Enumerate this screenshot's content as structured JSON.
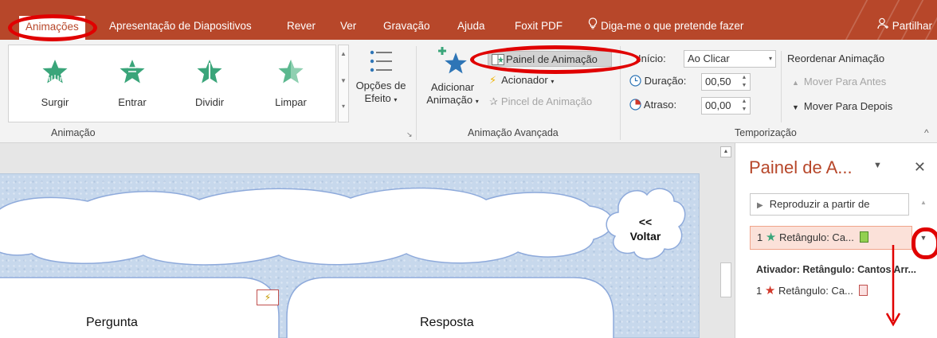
{
  "tabs": [
    {
      "label": "Animações",
      "active": true
    },
    {
      "label": "Apresentação de Diapositivos"
    },
    {
      "label": "Rever"
    },
    {
      "label": "Ver"
    },
    {
      "label": "Gravação"
    },
    {
      "label": "Ajuda"
    },
    {
      "label": "Foxit PDF"
    },
    {
      "label": "Diga-me o que pretende fazer",
      "icon": "lightbulb-icon"
    }
  ],
  "share_label": "Partilhar",
  "ribbon": {
    "animation_group": {
      "label": "Animação",
      "effects": [
        {
          "label": "Surgir",
          "icon": "star-appear-icon"
        },
        {
          "label": "Entrar",
          "icon": "star-fly-in-icon"
        },
        {
          "label": "Dividir",
          "icon": "star-split-icon"
        },
        {
          "label": "Limpar",
          "icon": "star-wipe-icon"
        }
      ],
      "effect_options_line1": "Opções de",
      "effect_options_line2": "Efeito"
    },
    "advanced_group": {
      "label": "Animação Avançada",
      "add_animation_line1": "Adicionar",
      "add_animation_line2": "Animação",
      "animation_pane": "Painel de Animação",
      "trigger": "Acionador",
      "animation_painter": "Pincel de Animação"
    },
    "timing_group": {
      "label": "Temporização",
      "start_label": "Início:",
      "start_value": "Ao Clicar",
      "duration_label": "Duração:",
      "duration_value": "00,50",
      "delay_label": "Atraso:",
      "delay_value": "00,00",
      "reorder_label": "Reordenar Animação",
      "move_earlier": "Mover Para Antes",
      "move_later": "Mover Para Depois"
    }
  },
  "slide": {
    "back_button_line1": "<<",
    "back_button_line2": "Voltar",
    "question_label": "Pergunta",
    "answer_label": "Resposta"
  },
  "pane": {
    "title": "Painel de A...",
    "play_from": "Reproduzir a partir de",
    "item1_number": "1",
    "item1_label": "Retângulo: Ca...",
    "trigger_label": "Ativador: Retângulo: Cantos Arr...",
    "item2_number": "1",
    "item2_label": "Retângulo: Ca..."
  },
  "colors": {
    "accent": "#b7472a",
    "annotation": "#e00000",
    "entrance_green": "#3aa57a",
    "exit_red": "#d2392b",
    "selected_row": "#fbe1d9"
  }
}
